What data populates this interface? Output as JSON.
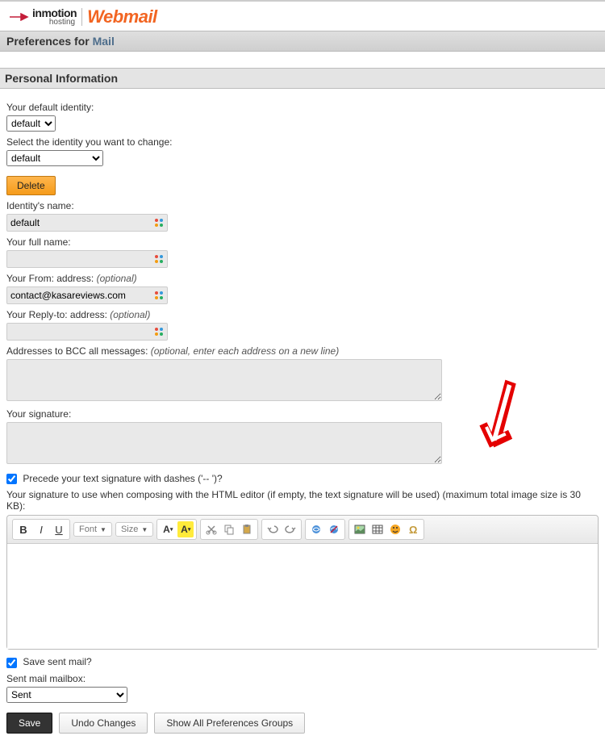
{
  "logo": {
    "brand_main": "inmotion",
    "brand_sub": "hosting",
    "product": "Webmail"
  },
  "header": {
    "prefix": "Preferences for ",
    "app": "Mail"
  },
  "section": {
    "title": "Personal Information"
  },
  "fields": {
    "default_identity_label": "Your default identity:",
    "default_identity_value": "default",
    "select_identity_label": "Select the identity you want to change:",
    "select_identity_value": "default",
    "delete_button": "Delete",
    "identity_name_label": "Identity's name:",
    "identity_name_value": "default",
    "full_name_label": "Your full name:",
    "full_name_value": "",
    "from_label_main": "Your From: address: ",
    "from_label_opt": "(optional)",
    "from_value": "contact@kasareviews.com",
    "reply_to_label_main": "Your Reply-to: address: ",
    "reply_to_label_opt": "(optional)",
    "reply_to_value": "",
    "bcc_label_main": "Addresses to BCC all messages: ",
    "bcc_label_opt": "(optional, enter each address on a new line)",
    "bcc_value": "",
    "signature_label": "Your signature:",
    "signature_value": "",
    "precede_dashes_label": "Precede your text signature with dashes ('-- ')?",
    "html_signature_label": "Your signature to use when composing with the HTML editor (if empty, the text signature will be used) (maximum total image size is 30 KB):",
    "save_sent_label": "Save sent mail?",
    "sent_mailbox_label": "Sent mail mailbox:",
    "sent_mailbox_value": "Sent"
  },
  "editor": {
    "font_dropdown": "Font",
    "size_dropdown": "Size"
  },
  "buttons": {
    "save": "Save",
    "undo": "Undo Changes",
    "show_all": "Show All Preferences Groups"
  }
}
